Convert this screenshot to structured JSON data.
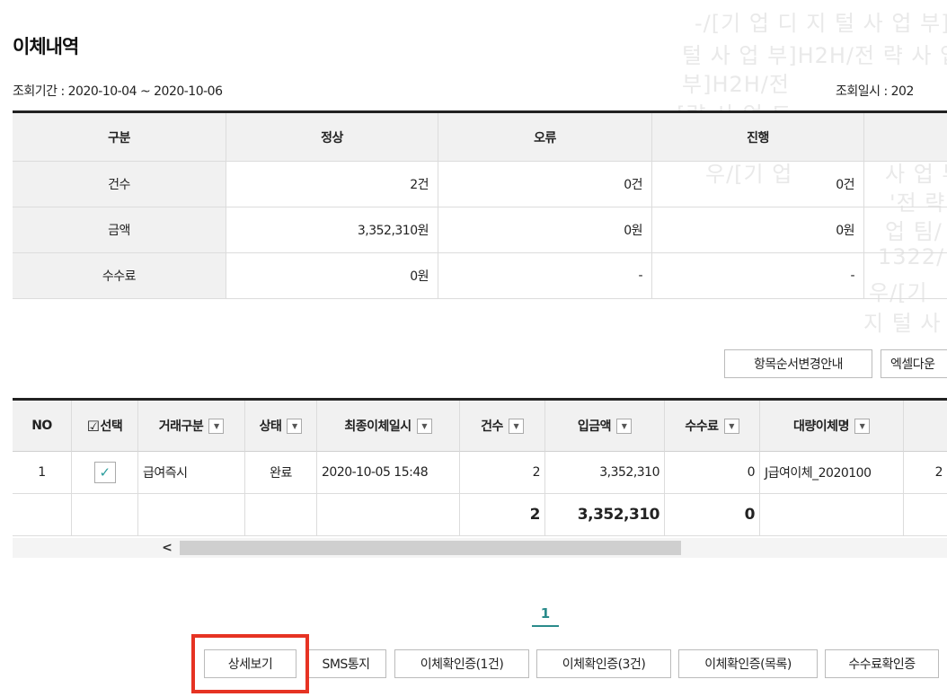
{
  "title": "이체내역",
  "period": "조회기간 : 2020-10-04 ~ 2020-10-06",
  "query_time": "조회일시 : 202",
  "watermark_lines": [
    "-/[기 업 디 지 털 사 업 부]",
    "털 사 업 부]H2H/전 략 사 업",
    "부]H2H/전",
    "[략 사 업 트",
    "51132",
    "우/[기 업",
    "업 디",
    "사 업 부",
    "'전 략",
    "업 팀/",
    "1322/",
    "우/[기",
    "지 털 사"
  ],
  "summary": {
    "headers": [
      "구분",
      "정상",
      "오류",
      "진행"
    ],
    "rows": [
      {
        "label": "건수",
        "normal": "2건",
        "error": "0건",
        "progress": "0건"
      },
      {
        "label": "금액",
        "normal": "3,352,310원",
        "error": "0원",
        "progress": "0원"
      },
      {
        "label": "수수료",
        "normal": "0원",
        "error": "-",
        "progress": "-"
      }
    ]
  },
  "buttons": {
    "order_guide": "항목순서변경안내",
    "excel": "엑셀다운"
  },
  "grid": {
    "headers": {
      "no": "NO",
      "select": "선택",
      "type": "거래구분",
      "status": "상태",
      "last_date": "최종이체일시",
      "count": "건수",
      "amount": "입금액",
      "fee": "수수료",
      "bulk_name": "대량이체명"
    },
    "rows": [
      {
        "no": "1",
        "checked": true,
        "type": "급여즉시",
        "status": "완료",
        "last_date": "2020-10-05 15:48",
        "count": "2",
        "amount": "3,352,310",
        "fee": "0",
        "bulk_name": "J급여이체_2020100",
        "extra": "2"
      }
    ],
    "total": {
      "count": "2",
      "amount": "3,352,310",
      "fee": "0"
    }
  },
  "pagination": {
    "current": "1"
  },
  "actions": [
    "상세보기",
    "SMS통지",
    "이체확인증(1건)",
    "이체확인증(3건)",
    "이체확인증(목록)",
    "수수료확인증"
  ],
  "colors": {
    "accent": "#2a8b8b",
    "highlight": "#e63323",
    "header_bg": "#f1f1f1"
  }
}
